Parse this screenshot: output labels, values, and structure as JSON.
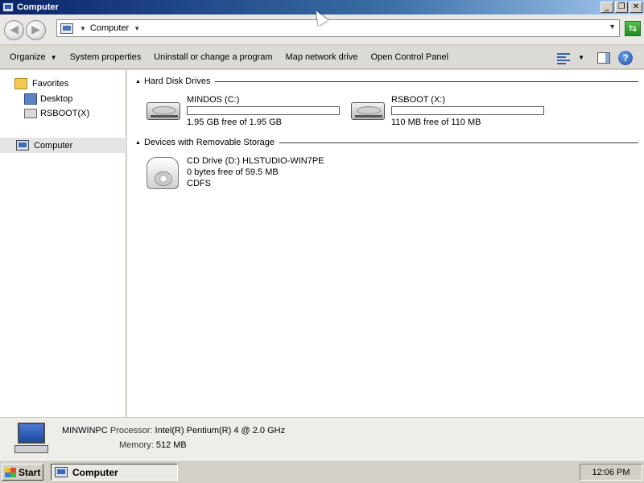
{
  "window": {
    "title": "Computer",
    "minimize_label": "_",
    "maximize_label": "❐",
    "close_label": "✕"
  },
  "address": {
    "back_label": "◀",
    "forward_label": "▶",
    "crumb": "Computer",
    "crumb_sep": "▼",
    "crumb_arrow": "▼",
    "dropdown": "▼",
    "refresh_label": "⇆"
  },
  "toolbar": {
    "organize": "Organize",
    "organize_dd": "▼",
    "system_properties": "System properties",
    "uninstall": "Uninstall or change a program",
    "map_drive": "Map network drive",
    "control_panel": "Open Control Panel",
    "views_dd": "▼",
    "help": "?"
  },
  "nav": {
    "favorites": "Favorites",
    "desktop": "Desktop",
    "rsboot": "RSBOOT(X)",
    "computer": "Computer"
  },
  "groups": {
    "hard_disks": "Hard Disk Drives",
    "removable": "Devices with Removable Storage",
    "caret": "▲"
  },
  "drives": [
    {
      "name": "MINDOS (C:)",
      "free": "1.95 GB free of 1.95 GB",
      "used_fraction": 0.0
    },
    {
      "name": "RSBOOT (X:)",
      "free": "110 MB free of 110 MB",
      "used_fraction": 0.0
    }
  ],
  "cd": {
    "name": "CD Drive (D:) HLSTUDIO-WIN7PE",
    "free": "0 bytes free of 59.5 MB",
    "fs": "CDFS"
  },
  "details": {
    "computer_name": "MINWINPC",
    "processor_label": "Processor:",
    "processor": "Intel(R) Pentium(R) 4   @ 2.0 GHz",
    "memory_label": "Memory:",
    "memory": "512 MB"
  },
  "taskbar": {
    "start": "Start",
    "task": "Computer",
    "clock": "12:06 PM"
  },
  "icons": [
    "computer-icon",
    "back-icon",
    "forward-icon",
    "refresh-icon",
    "views-icon",
    "preview-pane-icon",
    "help-icon",
    "favorites-icon",
    "desktop-icon",
    "drive-icon",
    "hard-disk-icon",
    "cd-drive-icon",
    "start-flag-icon"
  ]
}
